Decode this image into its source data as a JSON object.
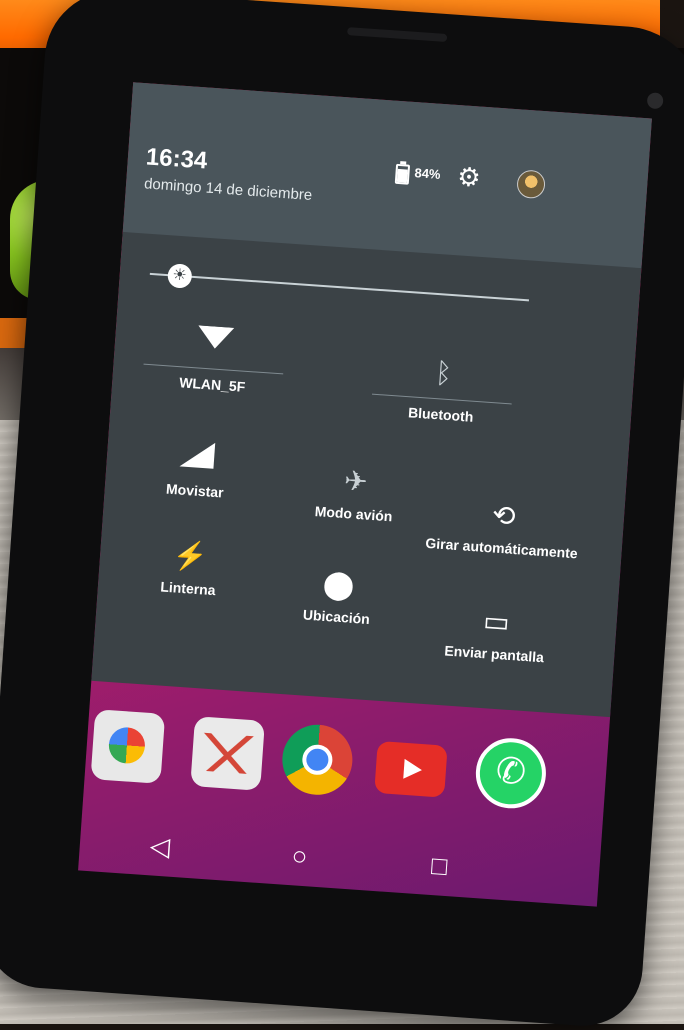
{
  "status": {
    "time": "16:34",
    "date": "domingo 14 de diciembre",
    "battery_pct": "84%",
    "battery_level": 0.84
  },
  "quick_settings": {
    "tiles": [
      {
        "id": "wifi",
        "label": "WLAN_5F",
        "icon": "wifi-icon"
      },
      {
        "id": "bluetooth",
        "label": "Bluetooth",
        "icon": "bluetooth-icon"
      },
      {
        "id": "mobile",
        "label": "Movistar",
        "icon": "signal-icon"
      },
      {
        "id": "airplane",
        "label": "Modo avión",
        "icon": "airplane-icon"
      },
      {
        "id": "rotate",
        "label": "Girar automáticamente",
        "icon": "rotate-icon"
      },
      {
        "id": "flashlight",
        "label": "Linterna",
        "icon": "flashlight-icon"
      },
      {
        "id": "location",
        "label": "Ubicación",
        "icon": "location-icon"
      },
      {
        "id": "cast",
        "label": "Enviar pantalla",
        "icon": "cast-icon"
      }
    ],
    "brightness_level": 0.05
  },
  "dock_apps": [
    "photos-icon",
    "gmail-icon",
    "chrome-icon",
    "youtube-icon",
    "whatsapp-icon"
  ],
  "nav": [
    "back-icon",
    "home-icon",
    "recents-icon"
  ]
}
